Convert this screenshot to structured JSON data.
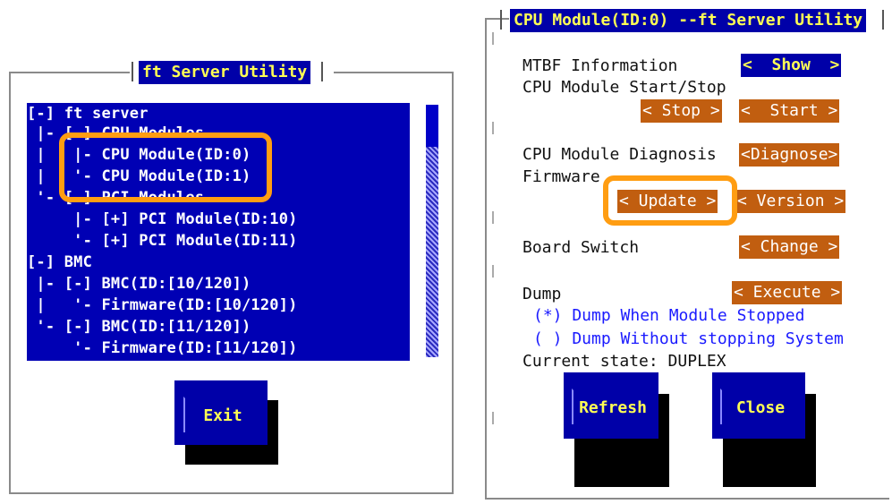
{
  "left_dialog": {
    "title": "ft Server Utility",
    "tree": [
      "[-] ft server",
      " |- [-] CPU Modules",
      " |   |- CPU Module(ID:0)",
      " |   '- CPU Module(ID:1)",
      " '- [-] PCI Modules",
      "     |- [+] PCI Module(ID:10)",
      "     '- [+] PCI Module(ID:11)",
      "[-] BMC",
      " |- [-] BMC(ID:[10/120])",
      " |   '- Firmware(ID:[10/120])",
      " '- [-] BMC(ID:[11/120])",
      "     '- Firmware(ID:[11/120])"
    ],
    "exit_label": "Exit"
  },
  "right_dialog": {
    "title": "CPU Module(ID:0) --ft Server Utility",
    "mtbf_label": "MTBF Information",
    "show_btn": "<  Show  >",
    "startstop_label": "CPU Module Start/Stop",
    "stop_btn": "< Stop >",
    "start_btn": "<  Start >",
    "diag_label": "CPU Module Diagnosis",
    "diag_btn": "<Diagnose>",
    "firmware_label": "Firmware",
    "update_btn": "< Update >",
    "version_btn": "< Version >",
    "board_label": "Board Switch",
    "change_btn": "< Change >",
    "dump_label": "Dump",
    "execute_btn": "< Execute >",
    "radio1": "(*) Dump When Module Stopped",
    "radio2": "( ) Dump Without stopping System",
    "state": "Current state: DUPLEX",
    "refresh_label": "Refresh",
    "close_label": "Close"
  },
  "colors": {
    "dialog_blue": "#0000b4",
    "title_yellow": "#ffff54",
    "action_orange": "#c15e10",
    "highlight_orange": "#ff9d12"
  }
}
